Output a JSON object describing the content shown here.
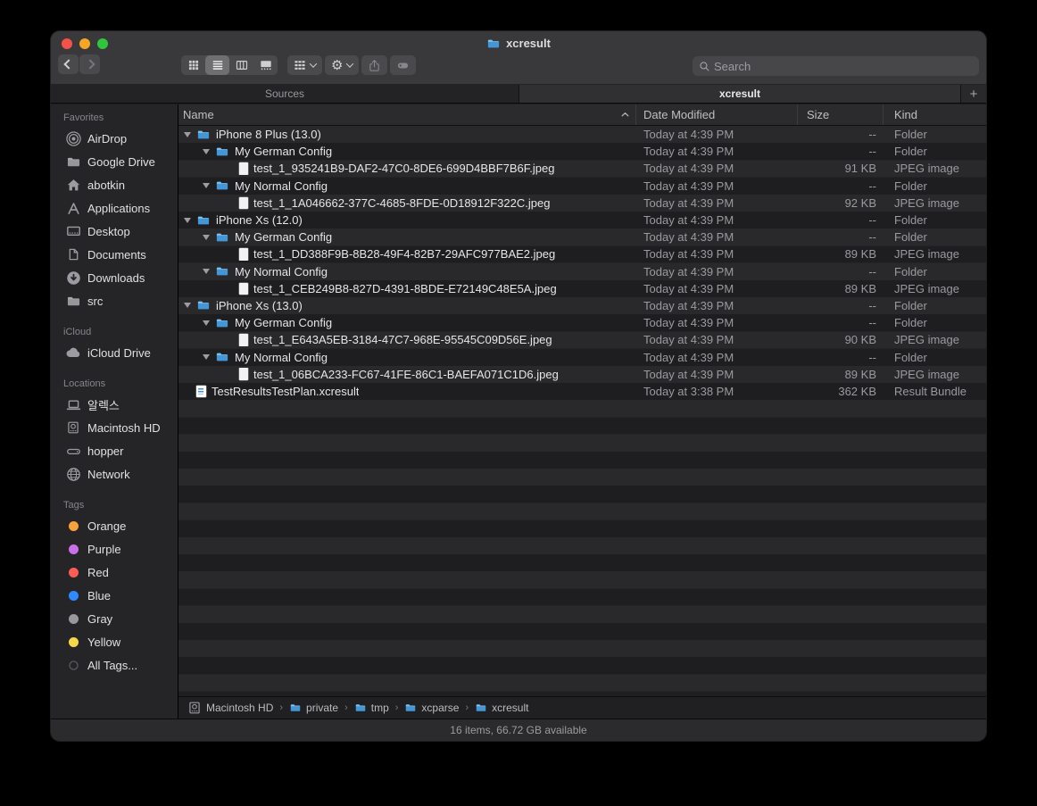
{
  "window": {
    "title": "xcresult"
  },
  "traffic_lights": {
    "close": "#f4514b",
    "minimize": "#f5a623",
    "zoom": "#2fc63e"
  },
  "toolbar": {
    "back_enabled": true,
    "forward_enabled": false,
    "view_buttons": [
      {
        "icon": "grid-view-icon",
        "selected": false
      },
      {
        "icon": "list-view-icon",
        "selected": true
      },
      {
        "icon": "column-view-icon",
        "selected": false
      },
      {
        "icon": "gallery-view-icon",
        "selected": false
      }
    ],
    "action_buttons": [
      {
        "icon": "group-icon",
        "chevron": true,
        "disabled": false
      },
      {
        "icon": "gear-icon",
        "chevron": true,
        "disabled": false
      },
      {
        "icon": "share-icon",
        "chevron": false,
        "disabled": true
      },
      {
        "icon": "tag-icon",
        "chevron": false,
        "disabled": true
      }
    ],
    "search_placeholder": "Search"
  },
  "tabs": {
    "items": [
      {
        "label": "Sources",
        "active": false
      },
      {
        "label": "xcresult",
        "active": true
      }
    ],
    "new_tab": "+"
  },
  "columns": {
    "name": "Name",
    "date": "Date Modified",
    "size": "Size",
    "kind": "Kind",
    "sort_column": "Name",
    "sort_direction": "asc"
  },
  "rows": [
    {
      "name": "iPhone 8 Plus (13.0)",
      "indent": 0,
      "icon": "folder-icon",
      "disclosure": true,
      "date": "Today at 4:39 PM",
      "size": "--",
      "kind": "Folder"
    },
    {
      "name": "My German Config",
      "indent": 1,
      "icon": "folder-icon",
      "disclosure": true,
      "date": "Today at 4:39 PM",
      "size": "--",
      "kind": "Folder"
    },
    {
      "name": "test_1_935241B9-DAF2-47C0-8DE6-699D4BBF7B6F.jpeg",
      "indent": 2,
      "icon": "jpeg-file-icon",
      "disclosure": false,
      "date": "Today at 4:39 PM",
      "size": "91 KB",
      "kind": "JPEG image"
    },
    {
      "name": "My Normal Config",
      "indent": 1,
      "icon": "folder-icon",
      "disclosure": true,
      "date": "Today at 4:39 PM",
      "size": "--",
      "kind": "Folder"
    },
    {
      "name": "test_1_1A046662-377C-4685-8FDE-0D18912F322C.jpeg",
      "indent": 2,
      "icon": "jpeg-file-icon",
      "disclosure": false,
      "date": "Today at 4:39 PM",
      "size": "92 KB",
      "kind": "JPEG image"
    },
    {
      "name": "iPhone Xs (12.0)",
      "indent": 0,
      "icon": "folder-icon",
      "disclosure": true,
      "date": "Today at 4:39 PM",
      "size": "--",
      "kind": "Folder"
    },
    {
      "name": "My German Config",
      "indent": 1,
      "icon": "folder-icon",
      "disclosure": true,
      "date": "Today at 4:39 PM",
      "size": "--",
      "kind": "Folder"
    },
    {
      "name": "test_1_DD388F9B-8B28-49F4-82B7-29AFC977BAE2.jpeg",
      "indent": 2,
      "icon": "jpeg-file-icon",
      "disclosure": false,
      "date": "Today at 4:39 PM",
      "size": "89 KB",
      "kind": "JPEG image"
    },
    {
      "name": "My Normal Config",
      "indent": 1,
      "icon": "folder-icon",
      "disclosure": true,
      "date": "Today at 4:39 PM",
      "size": "--",
      "kind": "Folder"
    },
    {
      "name": "test_1_CEB249B8-827D-4391-8BDE-E72149C48E5A.jpeg",
      "indent": 2,
      "icon": "jpeg-file-icon",
      "disclosure": false,
      "date": "Today at 4:39 PM",
      "size": "89 KB",
      "kind": "JPEG image"
    },
    {
      "name": "iPhone Xs (13.0)",
      "indent": 0,
      "icon": "folder-icon",
      "disclosure": true,
      "date": "Today at 4:39 PM",
      "size": "--",
      "kind": "Folder"
    },
    {
      "name": "My German Config",
      "indent": 1,
      "icon": "folder-icon",
      "disclosure": true,
      "date": "Today at 4:39 PM",
      "size": "--",
      "kind": "Folder"
    },
    {
      "name": "test_1_E643A5EB-3184-47C7-968E-95545C09D56E.jpeg",
      "indent": 2,
      "icon": "jpeg-file-icon",
      "disclosure": false,
      "date": "Today at 4:39 PM",
      "size": "90 KB",
      "kind": "JPEG image"
    },
    {
      "name": "My Normal Config",
      "indent": 1,
      "icon": "folder-icon",
      "disclosure": true,
      "date": "Today at 4:39 PM",
      "size": "--",
      "kind": "Folder"
    },
    {
      "name": "test_1_06BCA233-FC67-41FE-86C1-BAEFA071C1D6.jpeg",
      "indent": 2,
      "icon": "jpeg-file-icon",
      "disclosure": false,
      "date": "Today at 4:39 PM",
      "size": "89 KB",
      "kind": "JPEG image"
    },
    {
      "name": "TestResultsTestPlan.xcresult",
      "indent": 0,
      "icon": "result-bundle-icon",
      "disclosure": false,
      "date": "Today at 3:38 PM",
      "size": "362 KB",
      "kind": "Result Bundle"
    }
  ],
  "sidebar": {
    "sections": [
      {
        "title": "Favorites",
        "items": [
          {
            "label": "AirDrop",
            "icon": "airdrop-icon"
          },
          {
            "label": "Google Drive",
            "icon": "folder-icon"
          },
          {
            "label": "abotkin",
            "icon": "home-icon"
          },
          {
            "label": "Applications",
            "icon": "applications-icon"
          },
          {
            "label": "Desktop",
            "icon": "desktop-icon"
          },
          {
            "label": "Documents",
            "icon": "documents-icon"
          },
          {
            "label": "Downloads",
            "icon": "downloads-icon"
          },
          {
            "label": "src",
            "icon": "folder-icon"
          }
        ]
      },
      {
        "title": "iCloud",
        "items": [
          {
            "label": "iCloud Drive",
            "icon": "icloud-icon"
          }
        ]
      },
      {
        "title": "Locations",
        "items": [
          {
            "label": "알렉스",
            "icon": "laptop-icon"
          },
          {
            "label": "Macintosh HD",
            "icon": "internal-drive-icon"
          },
          {
            "label": "hopper",
            "icon": "external-drive-icon"
          },
          {
            "label": "Network",
            "icon": "network-icon"
          }
        ]
      },
      {
        "title": "Tags",
        "items": [
          {
            "label": "Orange",
            "icon": "tag-dot",
            "color": "#F7A23B"
          },
          {
            "label": "Purple",
            "icon": "tag-dot",
            "color": "#C96FE8"
          },
          {
            "label": "Red",
            "icon": "tag-dot",
            "color": "#FC5E55"
          },
          {
            "label": "Blue",
            "icon": "tag-dot",
            "color": "#2E8BFF"
          },
          {
            "label": "Gray",
            "icon": "tag-dot",
            "color": "#97979D"
          },
          {
            "label": "Yellow",
            "icon": "tag-dot",
            "color": "#F8D64A"
          },
          {
            "label": "All Tags...",
            "icon": "all-tags-icon"
          }
        ]
      }
    ]
  },
  "pathbar": [
    {
      "label": "Macintosh HD",
      "icon": "internal-drive-icon"
    },
    {
      "label": "private",
      "icon": "folder-icon"
    },
    {
      "label": "tmp",
      "icon": "folder-icon"
    },
    {
      "label": "xcparse",
      "icon": "folder-icon"
    },
    {
      "label": "xcresult",
      "icon": "folder-icon"
    }
  ],
  "statusbar": {
    "text": "16 items, 66.72 GB available"
  }
}
